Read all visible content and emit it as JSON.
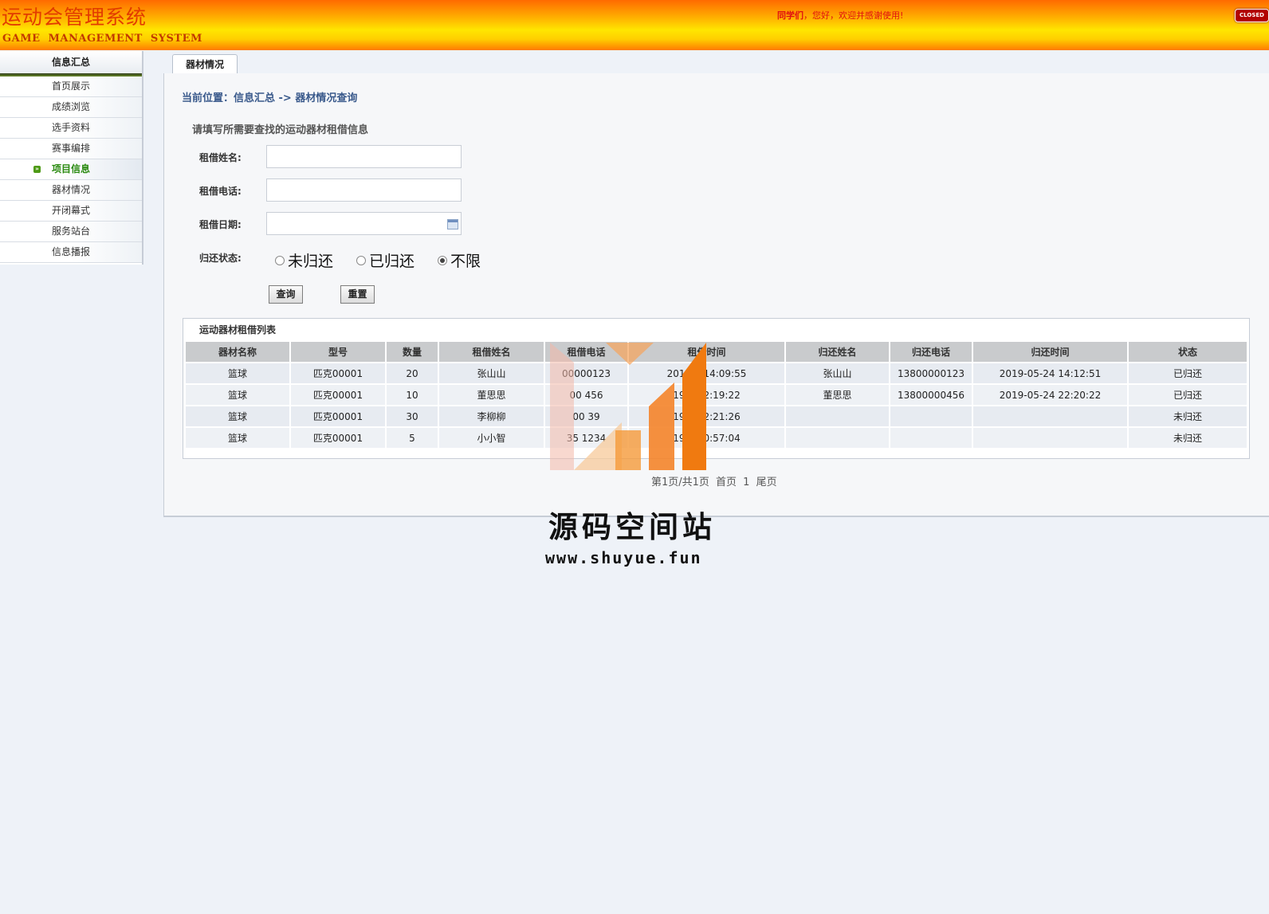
{
  "header": {
    "title": "运动会管理系统",
    "subtitle": "GAME MANAGEMENT SYSTEM",
    "welcome_user": "同学们",
    "welcome_text": "，您好，欢迎并感谢使用!",
    "close_label": "CLOSED"
  },
  "sidebar": {
    "heading": "信息汇总",
    "items": [
      {
        "label": "首页展示"
      },
      {
        "label": "成绩浏览"
      },
      {
        "label": "选手资料"
      },
      {
        "label": "赛事编排"
      },
      {
        "label": "项目信息",
        "active": true
      },
      {
        "label": "器材情况"
      },
      {
        "label": "开闭幕式"
      },
      {
        "label": "服务站台"
      },
      {
        "label": "信息播报"
      }
    ]
  },
  "tab": {
    "label": "器材情况"
  },
  "breadcrumb": "当前位置：信息汇总 -> 器材情况查询",
  "form": {
    "title": "请填写所需要查找的运动器材租借信息",
    "name_label": "租借姓名:",
    "name_value": "",
    "phone_label": "租借电话:",
    "phone_value": "",
    "date_label": "租借日期:",
    "date_value": "",
    "status_label": "归还状态:",
    "status_options": [
      "未归还",
      "已归还",
      "不限"
    ],
    "status_selected": "不限",
    "search_button": "查询",
    "reset_button": "重置"
  },
  "list": {
    "title": "运动器材租借列表",
    "columns": [
      "器材名称",
      "型号",
      "数量",
      "租借姓名",
      "租借电话",
      "租借时间",
      "归还姓名",
      "归还电话",
      "归还时间",
      "状态"
    ],
    "rows": [
      [
        "篮球",
        "匹克00001",
        "20",
        "张山山",
        "00000123",
        "2019  3 14:09:55",
        "张山山",
        "13800000123",
        "2019-05-24 14:12:51",
        "已归还"
      ],
      [
        "篮球",
        "匹克00001",
        "10",
        "董思思",
        "00  456",
        "19  3 22:19:22",
        "董思思",
        "13800000456",
        "2019-05-24 22:20:22",
        "已归还"
      ],
      [
        "篮球",
        "匹克00001",
        "30",
        "李柳柳",
        "00  39",
        "19  3 22:21:26",
        "",
        "",
        "",
        "未归还"
      ],
      [
        "篮球",
        "匹克00001",
        "5",
        "小小智",
        "35  1234",
        "19  1 10:57:04",
        "",
        "",
        "",
        "未归还"
      ]
    ]
  },
  "pager": "第1页/共1页  首页  1  尾页",
  "watermark": {
    "text": "源码空间站",
    "url": "www.shuyue.fun"
  },
  "colors": {
    "accent_green": "#2a8a10",
    "header_red": "#e23b00",
    "welcome_red": "#e01010",
    "breadcrumb_blue": "#3a5a8c"
  }
}
